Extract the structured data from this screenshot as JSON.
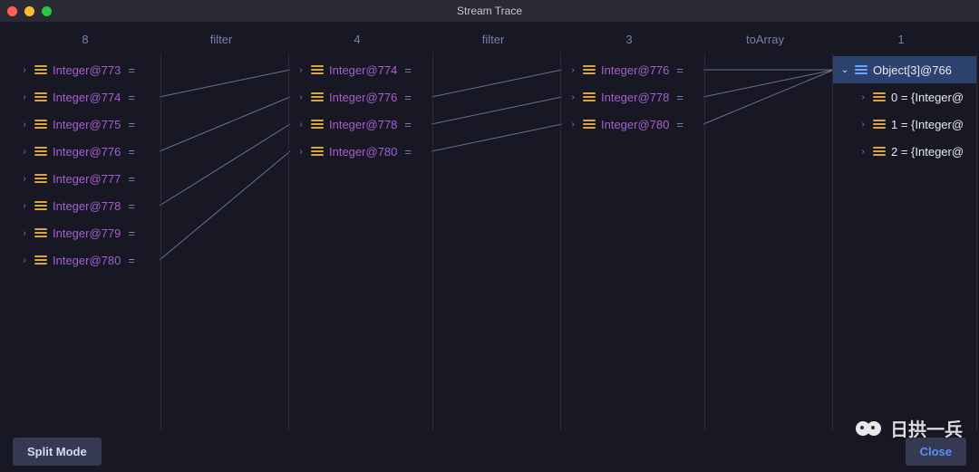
{
  "window": {
    "title": "Stream Trace"
  },
  "headers": [
    "8",
    "filter",
    "4",
    "filter",
    "3",
    "toArray",
    "1"
  ],
  "columns": [
    {
      "role": "data",
      "nodes": [
        {
          "label": "Integer@773",
          "suffix": " =",
          "icon": "bars",
          "expand": "right",
          "white": false
        },
        {
          "label": "Integer@774",
          "suffix": " =",
          "icon": "bars",
          "expand": "right",
          "white": false
        },
        {
          "label": "Integer@775",
          "suffix": " =",
          "icon": "bars",
          "expand": "right",
          "white": false
        },
        {
          "label": "Integer@776",
          "suffix": " =",
          "icon": "bars",
          "expand": "right",
          "white": false
        },
        {
          "label": "Integer@777",
          "suffix": " =",
          "icon": "bars",
          "expand": "right",
          "white": false
        },
        {
          "label": "Integer@778",
          "suffix": " =",
          "icon": "bars",
          "expand": "right",
          "white": false
        },
        {
          "label": "Integer@779",
          "suffix": " =",
          "icon": "bars",
          "expand": "right",
          "white": false
        },
        {
          "label": "Integer@780",
          "suffix": " =",
          "icon": "bars",
          "expand": "right",
          "white": false
        }
      ]
    },
    {
      "role": "op"
    },
    {
      "role": "data",
      "nodes": [
        {
          "label": "Integer@774",
          "suffix": " =",
          "icon": "bars",
          "expand": "right",
          "white": false
        },
        {
          "label": "Integer@776",
          "suffix": " =",
          "icon": "bars",
          "expand": "right",
          "white": false
        },
        {
          "label": "Integer@778",
          "suffix": " =",
          "icon": "bars",
          "expand": "right",
          "white": false
        },
        {
          "label": "Integer@780",
          "suffix": " =",
          "icon": "bars",
          "expand": "right",
          "white": false
        }
      ]
    },
    {
      "role": "op"
    },
    {
      "role": "data",
      "nodes": [
        {
          "label": "Integer@776",
          "suffix": " =",
          "icon": "bars",
          "expand": "right",
          "white": false
        },
        {
          "label": "Integer@778",
          "suffix": " =",
          "icon": "bars",
          "expand": "right",
          "white": false
        },
        {
          "label": "Integer@780",
          "suffix": " =",
          "icon": "bars",
          "expand": "right",
          "white": false
        }
      ]
    },
    {
      "role": "op"
    },
    {
      "role": "data",
      "nodes": [
        {
          "label": "Object[3]@766",
          "suffix": "",
          "icon": "list",
          "expand": "down",
          "white": true,
          "selected": true
        },
        {
          "label": "0 = {Integer@",
          "suffix": "",
          "icon": "bars",
          "expand": "right",
          "white": true,
          "child": true
        },
        {
          "label": "1 = {Integer@",
          "suffix": "",
          "icon": "bars",
          "expand": "right",
          "white": true,
          "child": true
        },
        {
          "label": "2 = {Integer@",
          "suffix": "",
          "icon": "bars",
          "expand": "right",
          "white": true,
          "child": true
        }
      ]
    }
  ],
  "links": [
    {
      "from": [
        0,
        1
      ],
      "to": [
        2,
        0
      ]
    },
    {
      "from": [
        0,
        3
      ],
      "to": [
        2,
        1
      ]
    },
    {
      "from": [
        0,
        5
      ],
      "to": [
        2,
        2
      ]
    },
    {
      "from": [
        0,
        7
      ],
      "to": [
        2,
        3
      ]
    },
    {
      "from": [
        2,
        1
      ],
      "to": [
        4,
        0
      ]
    },
    {
      "from": [
        2,
        2
      ],
      "to": [
        4,
        1
      ]
    },
    {
      "from": [
        2,
        3
      ],
      "to": [
        4,
        2
      ]
    },
    {
      "from": [
        4,
        0
      ],
      "to": [
        6,
        0
      ]
    },
    {
      "from": [
        4,
        1
      ],
      "to": [
        6,
        0
      ]
    },
    {
      "from": [
        4,
        2
      ],
      "to": [
        6,
        0
      ]
    }
  ],
  "footer": {
    "split_mode": "Split Mode",
    "close": "Close"
  },
  "watermark": "日拱一兵",
  "colors": {
    "line": "#6a6f8c"
  }
}
